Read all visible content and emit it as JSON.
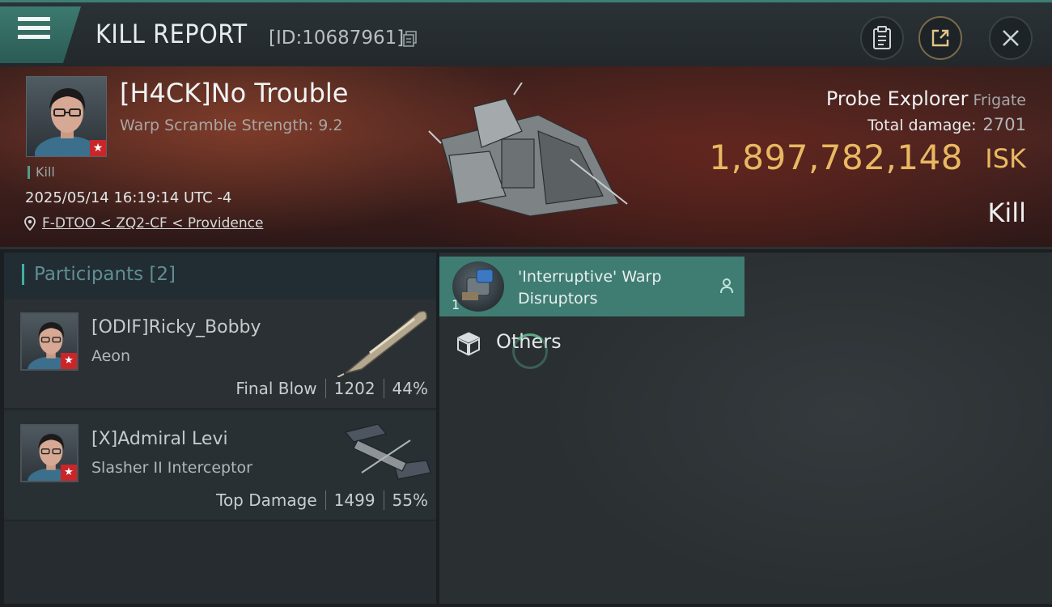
{
  "header": {
    "title": "KILL REPORT",
    "report_id": "[ID:10687961]"
  },
  "victim": {
    "name": "[H4CK]No Trouble",
    "scramble": "Warp Scramble Strength: 9.2",
    "tag": "Kill",
    "datetime": "2025/05/14 16:19:14 UTC -4",
    "location": "F-DTOO < ZQ2-CF < Providence"
  },
  "ship": {
    "name": "Probe Explorer",
    "class": "Frigate",
    "total_damage_label": "Total damage:",
    "total_damage_value": "2701",
    "isk_value": "1,897,782,148",
    "isk_unit": "ISK",
    "result": "Kill"
  },
  "participants": {
    "title": "Participants [2]",
    "rows": [
      {
        "name": "[ODIF]Ricky_Bobby",
        "ship": "Aeon",
        "role": "Final Blow",
        "damage": "1202",
        "percent": "44%"
      },
      {
        "name": "[X]Admiral Levi",
        "ship": "Slasher II Interceptor",
        "role": "Top Damage",
        "damage": "1499",
        "percent": "55%"
      }
    ]
  },
  "items": {
    "selected": {
      "name": "'Interruptive' Warp Disruptors",
      "qty": "1"
    },
    "others_label": "Others"
  },
  "colors": {
    "accent_teal": "#3f7d73",
    "isk_gold": "#e9b862",
    "badge_red": "#c9262a"
  }
}
